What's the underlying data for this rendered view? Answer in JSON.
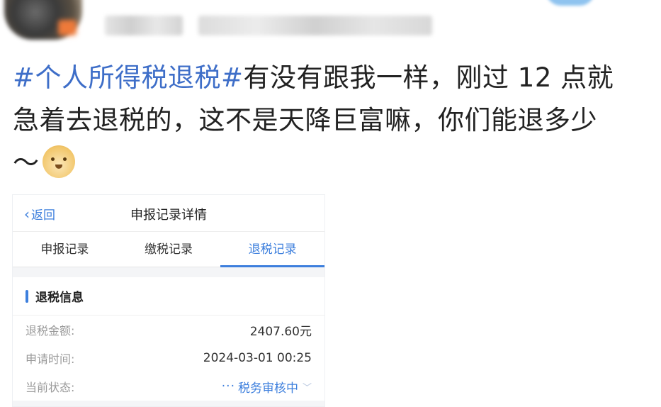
{
  "post": {
    "hashtag": "#个人所得税退税#",
    "line1_rest": "有没有跟我一样，刚过 12 点就",
    "line2": "急着去退税的，这不是天降巨富嘛，你们能退多少",
    "line3": "～"
  },
  "app": {
    "navbar": {
      "back_label": "返回",
      "title": "申报记录详情"
    },
    "tabs": [
      {
        "label": "申报记录",
        "active": false
      },
      {
        "label": "缴税记录",
        "active": false
      },
      {
        "label": "退税记录",
        "active": true
      }
    ],
    "section_title": "退税信息",
    "rows": [
      {
        "label": "退税金额:",
        "value": "2407.60元"
      },
      {
        "label": "申请时间:",
        "value": "2024-03-01 00:25"
      },
      {
        "label": "当前状态:",
        "value": "税务审核中"
      }
    ],
    "status_dots": "···"
  },
  "colors": {
    "accent": "#3d7fdd",
    "hashtag": "#3e6ec8",
    "text": "#222222",
    "label": "#9a9a9a"
  },
  "icons": {
    "emoji": "doge-emoji-icon",
    "back": "chevron-left-icon",
    "status": "chevron-down-icon"
  }
}
